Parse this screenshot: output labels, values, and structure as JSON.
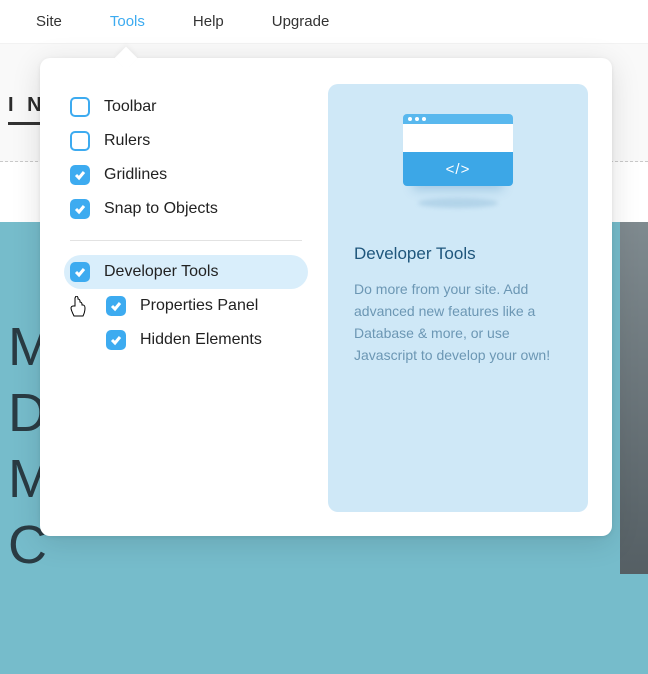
{
  "menubar": {
    "items": [
      {
        "label": "Site",
        "active": false
      },
      {
        "label": "Tools",
        "active": true
      },
      {
        "label": "Help",
        "active": false
      },
      {
        "label": "Upgrade",
        "active": false
      }
    ]
  },
  "backdrop": {
    "tab_fragment": "I N",
    "letters": "M\nD\nM\nC"
  },
  "checklist": {
    "toolbar": {
      "label": "Toolbar",
      "checked": false
    },
    "rulers": {
      "label": "Rulers",
      "checked": false
    },
    "gridlines": {
      "label": "Gridlines",
      "checked": true
    },
    "snap": {
      "label": "Snap to Objects",
      "checked": true
    },
    "devtools": {
      "label": "Developer Tools",
      "checked": true,
      "highlighted": true
    },
    "properties": {
      "label": "Properties Panel",
      "checked": true
    },
    "hidden": {
      "label": "Hidden Elements",
      "checked": true
    }
  },
  "infocard": {
    "code_glyph": "</>",
    "title": "Developer Tools",
    "body": "Do more from your site. Add advanced new features like a Database & more, or use Javascript to develop your own!"
  }
}
